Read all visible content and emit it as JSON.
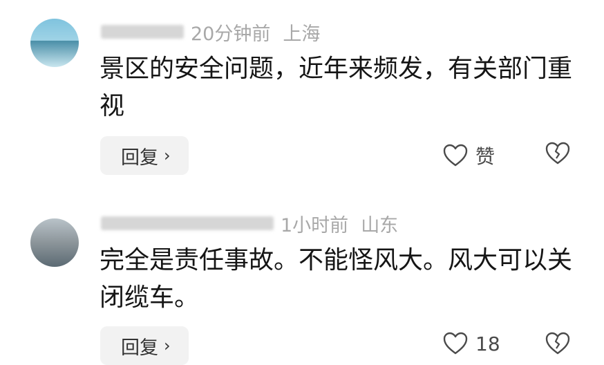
{
  "comments": [
    {
      "username": "",
      "time": "20分钟前",
      "location": "上海",
      "text": "景区的安全问题，近年来频发，有关部门重视",
      "reply_label": "回复",
      "reply_chevron": "›",
      "like_label": "赞",
      "icons": {
        "like": "heart-outline-icon",
        "dislike": "broken-heart-icon"
      }
    },
    {
      "username": "",
      "time": "1小时前",
      "location": "山东",
      "text": "完全是责任事故。不能怪风大。风大可以关闭缆车。",
      "reply_label": "回复",
      "reply_chevron": "›",
      "like_label": "18",
      "icons": {
        "like": "heart-outline-icon",
        "dislike": "broken-heart-icon"
      }
    }
  ]
}
